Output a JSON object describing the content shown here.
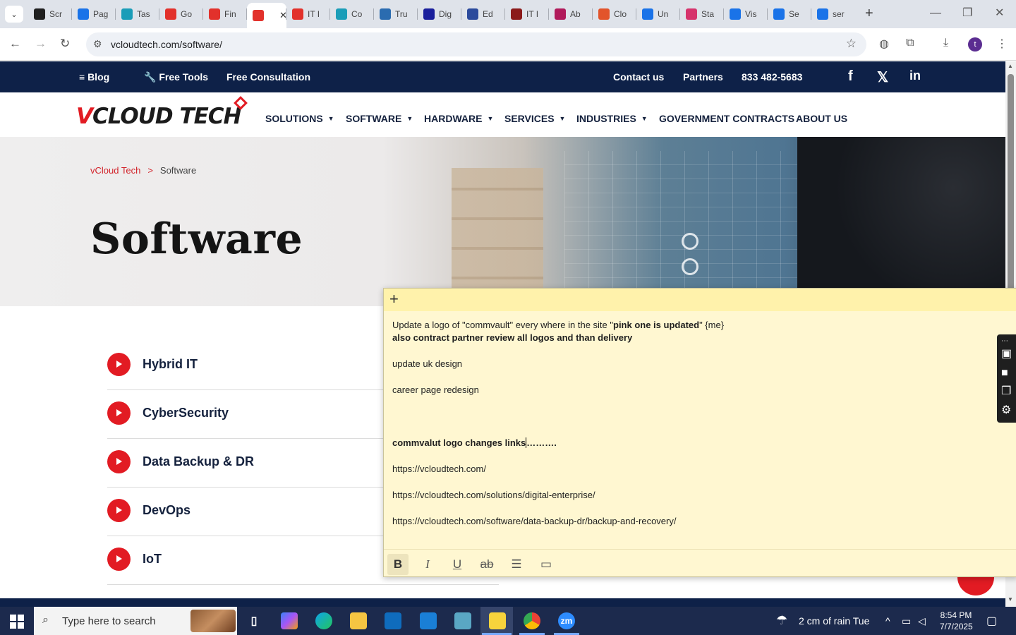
{
  "browser": {
    "tabs": [
      {
        "label": "Scr",
        "color": "#1f1f1f"
      },
      {
        "label": "Pag",
        "color": "#1a73e8"
      },
      {
        "label": "Tas",
        "color": "#1b9db8"
      },
      {
        "label": "Go",
        "color": "#e2312b"
      },
      {
        "label": "Fin",
        "color": "#e2312b"
      },
      {
        "label": "",
        "color": "#e2312b",
        "active": true
      },
      {
        "label": "IT I",
        "color": "#e2312b"
      },
      {
        "label": "Co",
        "color": "#1b9db8"
      },
      {
        "label": "Tru",
        "color": "#2b6cb0"
      },
      {
        "label": "Dig",
        "color": "#1a1f9c"
      },
      {
        "label": "Ed",
        "color": "#2b4a9c"
      },
      {
        "label": "IT I",
        "color": "#8b1a1a"
      },
      {
        "label": "Ab",
        "color": "#b01a5a"
      },
      {
        "label": "Clo",
        "color": "#e2542b"
      },
      {
        "label": "Un",
        "color": "#1a73e8"
      },
      {
        "label": "Sta",
        "color": "#d6336c"
      },
      {
        "label": "Vis",
        "color": "#1a73e8"
      },
      {
        "label": "Se",
        "color": "#1a73e8"
      },
      {
        "label": "ser",
        "color": "#1a73e8"
      }
    ],
    "url": "vcloudtech.com/software/",
    "profile_initial": "t"
  },
  "site": {
    "topbar": {
      "blog": "Blog",
      "free_tools": "Free Tools",
      "free_consultation": "Free Consultation",
      "contact": "Contact us",
      "partners": "Partners",
      "phone": "833 482-5683"
    },
    "logo": {
      "v": "V",
      "rest": "CLOUD TECH"
    },
    "nav": [
      {
        "label": "SOLUTIONS",
        "dropdown": true
      },
      {
        "label": "SOFTWARE",
        "dropdown": true
      },
      {
        "label": "HARDWARE",
        "dropdown": true
      },
      {
        "label": "SERVICES",
        "dropdown": true
      },
      {
        "label": "INDUSTRIES",
        "dropdown": true
      },
      {
        "label": "GOVERNMENT CONTRACTS",
        "dropdown": false
      },
      {
        "label": "ABOUT US",
        "dropdown": false
      }
    ],
    "breadcrumb": {
      "home": "vCloud Tech",
      "sep": ">",
      "current": "Software"
    },
    "hero_title": "Software",
    "categories": [
      "Hybrid IT",
      "CyberSecurity",
      "Data Backup & DR",
      "DevOps",
      "IoT"
    ]
  },
  "sticky_note": {
    "line1_a": "Update a logo of \"commvault\" every where in the site \"",
    "line1_b": "pink one is updated",
    "line1_c": "\" {me}",
    "line2": "also contract partner review all logos and than delivery",
    "line3": "update uk design",
    "line4": "career page redesign",
    "line5_a": "commvalut logo changes links",
    "line5_b": "……….",
    "link1": "https://vcloudtech.com/",
    "link2": "https://vcloudtech.com/solutions/digital-enterprise/",
    "link3": "https://vcloudtech.com/software/data-backup-dr/backup-and-recovery/"
  },
  "taskbar": {
    "search_placeholder": "Type here to search",
    "weather": "2 cm of rain Tue",
    "time": "8:54 PM",
    "date": "7/7/2025"
  }
}
